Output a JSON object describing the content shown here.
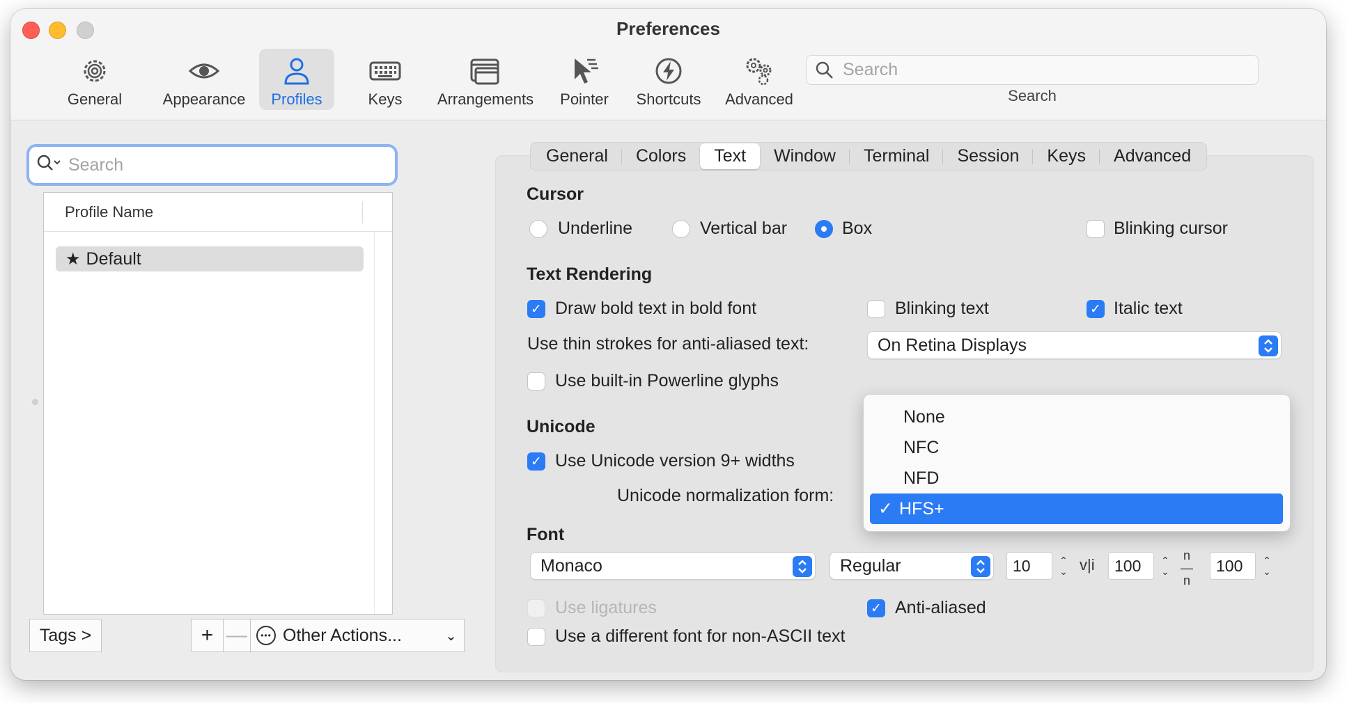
{
  "window": {
    "title": "Preferences"
  },
  "toolbar": {
    "items": [
      {
        "label": "General",
        "icon": "gear-icon"
      },
      {
        "label": "Appearance",
        "icon": "eye-icon"
      },
      {
        "label": "Profiles",
        "icon": "person-icon",
        "active": true
      },
      {
        "label": "Keys",
        "icon": "keyboard-icon"
      },
      {
        "label": "Arrangements",
        "icon": "windows-icon"
      },
      {
        "label": "Pointer",
        "icon": "pointer-icon"
      },
      {
        "label": "Shortcuts",
        "icon": "bolt-icon"
      },
      {
        "label": "Advanced",
        "icon": "gears-icon"
      }
    ],
    "search": {
      "placeholder": "Search",
      "label": "Search"
    }
  },
  "sidebar": {
    "search_placeholder": "Search",
    "column_header": "Profile Name",
    "profiles": [
      {
        "name": "Default",
        "starred": true
      }
    ],
    "tags_button": "Tags >",
    "add_button": "+",
    "remove_button": "—",
    "other_actions": "Other Actions..."
  },
  "tabs": {
    "items": [
      "General",
      "Colors",
      "Text",
      "Window",
      "Terminal",
      "Session",
      "Keys",
      "Advanced"
    ],
    "active": "Text"
  },
  "cursor": {
    "title": "Cursor",
    "options": [
      "Underline",
      "Vertical bar",
      "Box"
    ],
    "selected": "Box",
    "blinking_label": "Blinking cursor",
    "blinking": false
  },
  "text_rendering": {
    "title": "Text Rendering",
    "bold_label": "Draw bold text in bold font",
    "bold": true,
    "blinking_text_label": "Blinking text",
    "blinking_text": false,
    "italic_label": "Italic text",
    "italic": true,
    "thin_strokes_label": "Use thin strokes for anti-aliased text:",
    "thin_strokes_value": "On Retina Displays",
    "powerline_label": "Use built-in Powerline glyphs",
    "powerline": false
  },
  "unicode": {
    "title": "Unicode",
    "widths_label": "Use Unicode version 9+ widths",
    "widths": true,
    "normalization_label": "Unicode normalization form:",
    "menu_options": [
      "None",
      "NFC",
      "NFD",
      "HFS+"
    ],
    "selected": "HFS+"
  },
  "font": {
    "title": "Font",
    "family": "Monaco",
    "style": "Regular",
    "size": "10",
    "horizontal_spacing": "100",
    "vertical_spacing": "100",
    "ligatures_label": "Use ligatures",
    "ligatures_enabled": false,
    "antialiased_label": "Anti-aliased",
    "antialiased": true,
    "non_ascii_label": "Use a different font for non-ASCII text",
    "non_ascii": false
  },
  "colors": {
    "accent": "#2a7bf4",
    "close": "#fe5f57",
    "minimize": "#febc2e",
    "zoom": "#d0d0d0"
  }
}
